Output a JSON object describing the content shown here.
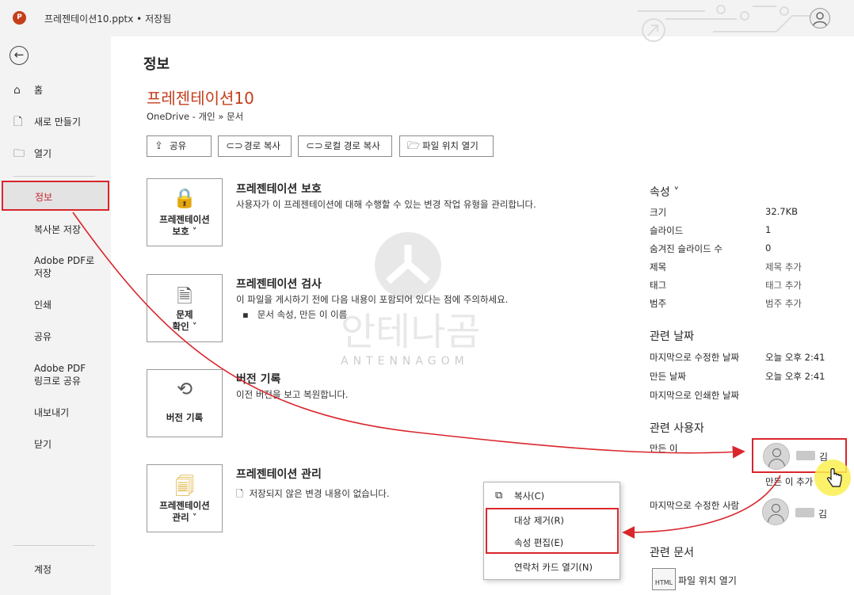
{
  "titlebar": {
    "app_icon": "P",
    "title": "프레젠테이션10.pptx • 저장됨",
    "icons": {
      "app": "powerpoint-icon",
      "account": "user-icon"
    }
  },
  "sidebar": {
    "back_icon": "back-arrow-icon",
    "items": [
      {
        "label": "홈",
        "icon": "home-icon"
      },
      {
        "label": "새로 만들기",
        "icon": "new-file-icon"
      },
      {
        "label": "열기",
        "icon": "folder-icon"
      },
      {
        "label": "정보"
      },
      {
        "label": "복사본 저장"
      },
      {
        "label": "Adobe PDF로 저장"
      },
      {
        "label": "인쇄"
      },
      {
        "label": "공유"
      },
      {
        "label": "Adobe PDF 링크로 공유"
      },
      {
        "label": "내보내기"
      },
      {
        "label": "닫기"
      },
      {
        "label": "계정"
      }
    ]
  },
  "main": {
    "page_title": "정보",
    "doc_name": "프레젠테이션10",
    "doc_path": "OneDrive - 개인 » 문서",
    "buttons": [
      {
        "label": "공유",
        "icon": "share-icon"
      },
      {
        "label": "경로 복사",
        "icon": "link-icon"
      },
      {
        "label": "로컬 경로 복사",
        "icon": "link-icon"
      },
      {
        "label": "파일 위치 열기",
        "icon": "folder-open-icon"
      }
    ],
    "sections": [
      {
        "box_label_1": "프레젠테이션",
        "box_label_2": "보호 ˅",
        "title": "프레젠테이션 보호",
        "desc": "사용자가 이 프레젠테이션에 대해 수행할 수 있는 변경 작업 유형을 관리합니다."
      },
      {
        "box_label_1": "문제",
        "box_label_2": "확인 ˅",
        "title": "프레젠테이션 검사",
        "desc": "이 파일을 게시하기 전에 다음 내용이 포함되어 있다는 점에 주의하세요.",
        "bullet": "문서 속성, 만든 이 이름"
      },
      {
        "box_label_1": "버전 기록",
        "title": "버전 기록",
        "desc": "이전 버전을 보고 복원합니다."
      },
      {
        "box_label_1": "프레젠테이션",
        "box_label_2": "관리 ˅",
        "title": "프레젠테이션 관리",
        "desc": "저장되지 않은 변경 내용이 없습니다."
      }
    ]
  },
  "properties": {
    "heading": "속성 ˅",
    "rows": [
      {
        "label": "크기",
        "value": "32.7KB"
      },
      {
        "label": "슬라이드",
        "value": "1"
      },
      {
        "label": "숨겨진 슬라이드 수",
        "value": "0"
      },
      {
        "label": "제목",
        "value": "제목 추가"
      },
      {
        "label": "태그",
        "value": "태그 추가"
      },
      {
        "label": "범주",
        "value": "범주 추가"
      }
    ],
    "dates_heading": "관련 날짜",
    "dates": [
      {
        "label": "마지막으로 수정한 날짜",
        "value": "오늘 오후 2:41"
      },
      {
        "label": "만든 날짜",
        "value": "오늘 오후 2:41"
      },
      {
        "label": "마지막으로 인쇄한 날짜",
        "value": ""
      }
    ],
    "people_heading": "관련 사용자",
    "author_label": "만든 이",
    "author_name": "김",
    "add_author": "만든 이 추가",
    "modified_by_label": "마지막으로 수정한 사람",
    "modified_by_name": "김",
    "docs_heading": "관련 문서",
    "open_location": "파일 위치 열기",
    "html_icon_text": "HTML"
  },
  "context_menu": {
    "items": [
      {
        "label": "복사(C)",
        "icon": "copy-icon"
      },
      {
        "label": "대상 제거(R)"
      },
      {
        "label": "속성 편집(E)"
      },
      {
        "label": "연락처 카드 열기(N)"
      }
    ]
  },
  "watermark": {
    "text": "ANTENNAGOM",
    "korean": "안테나곰"
  },
  "colors": {
    "accent": "#c43e1c",
    "highlight": "#d9262c",
    "sidebar_bg": "#f3f3f3"
  }
}
